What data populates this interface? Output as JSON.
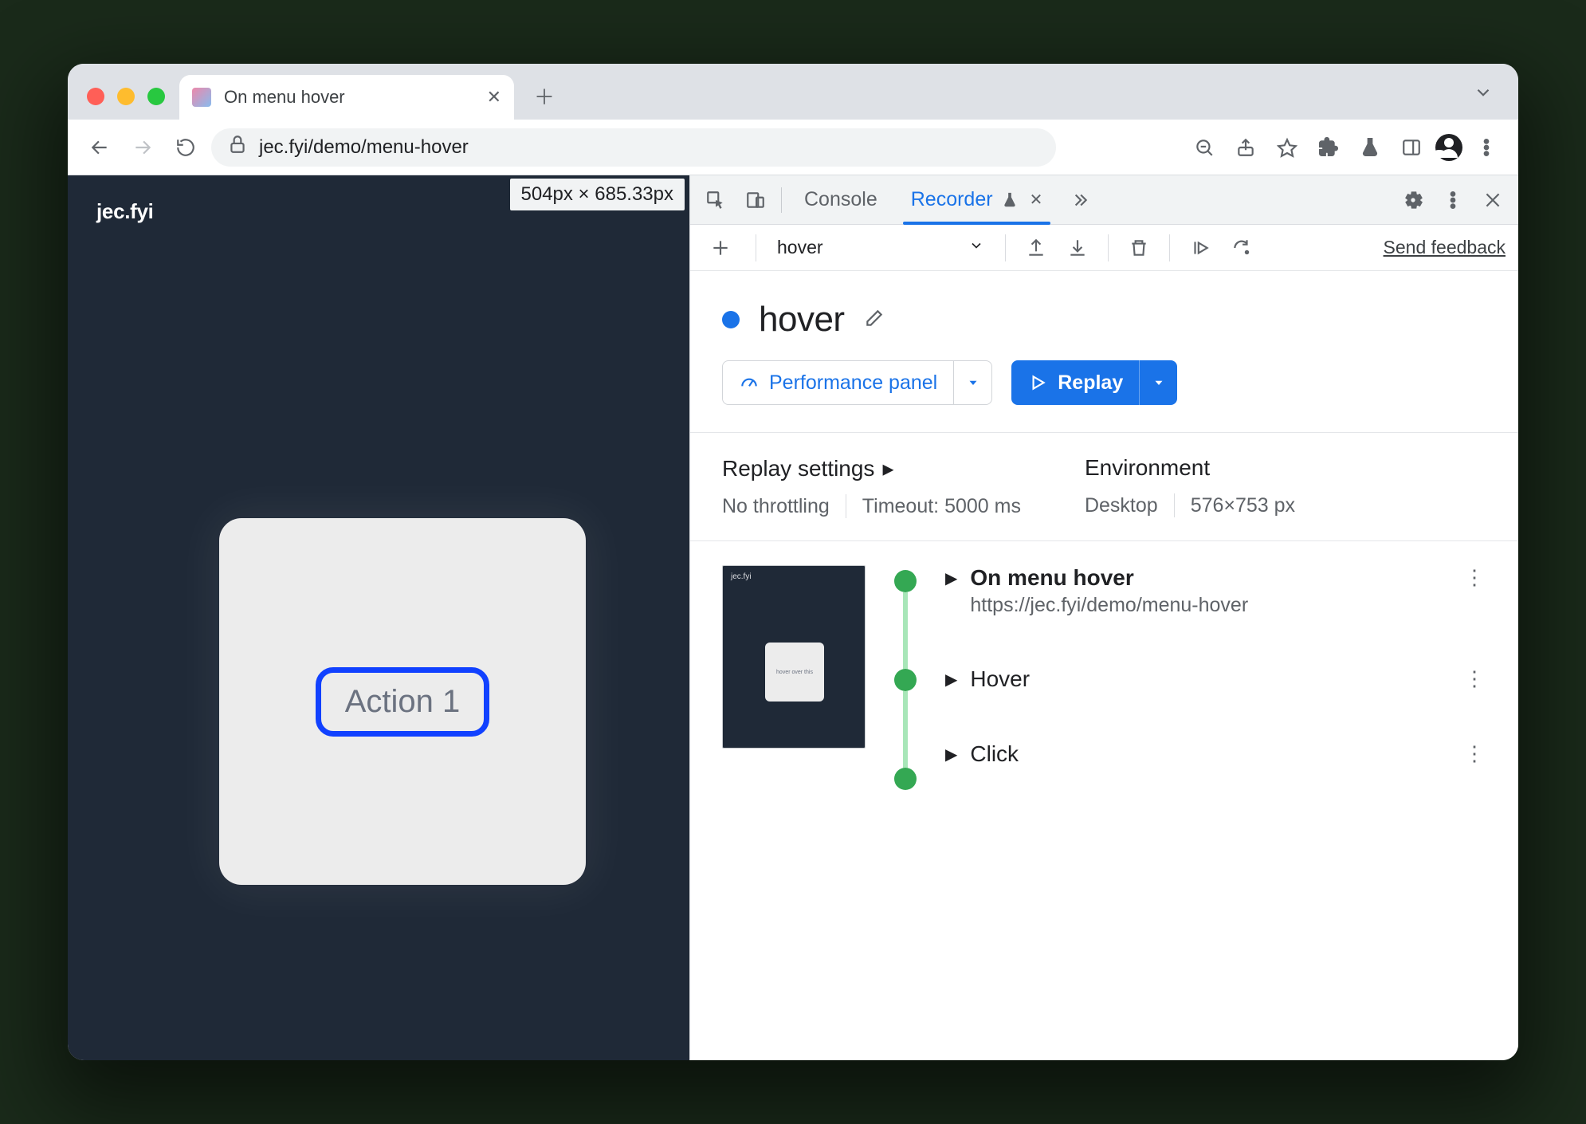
{
  "browser": {
    "tab_title": "On menu hover",
    "url_display": "jec.fyi/demo/menu-hover"
  },
  "page": {
    "brand": "jec.fyi",
    "dimension_tooltip": "504px × 685.33px",
    "card_chip_label": "Action 1"
  },
  "devtools": {
    "tabs": {
      "console": "Console",
      "recorder": "Recorder"
    },
    "subbar": {
      "recording_select": "hover",
      "feedback": "Send feedback"
    },
    "recording": {
      "name": "hover",
      "perf_button": "Performance panel",
      "replay_button": "Replay",
      "settings": {
        "replay_heading": "Replay settings",
        "throttling": "No throttling",
        "timeout": "Timeout: 5000 ms",
        "env_heading": "Environment",
        "device": "Desktop",
        "viewport": "576×753 px"
      },
      "steps": [
        {
          "title": "On menu hover",
          "subtitle": "https://jec.fyi/demo/menu-hover"
        },
        {
          "title": "Hover"
        },
        {
          "title": "Click"
        }
      ]
    }
  }
}
